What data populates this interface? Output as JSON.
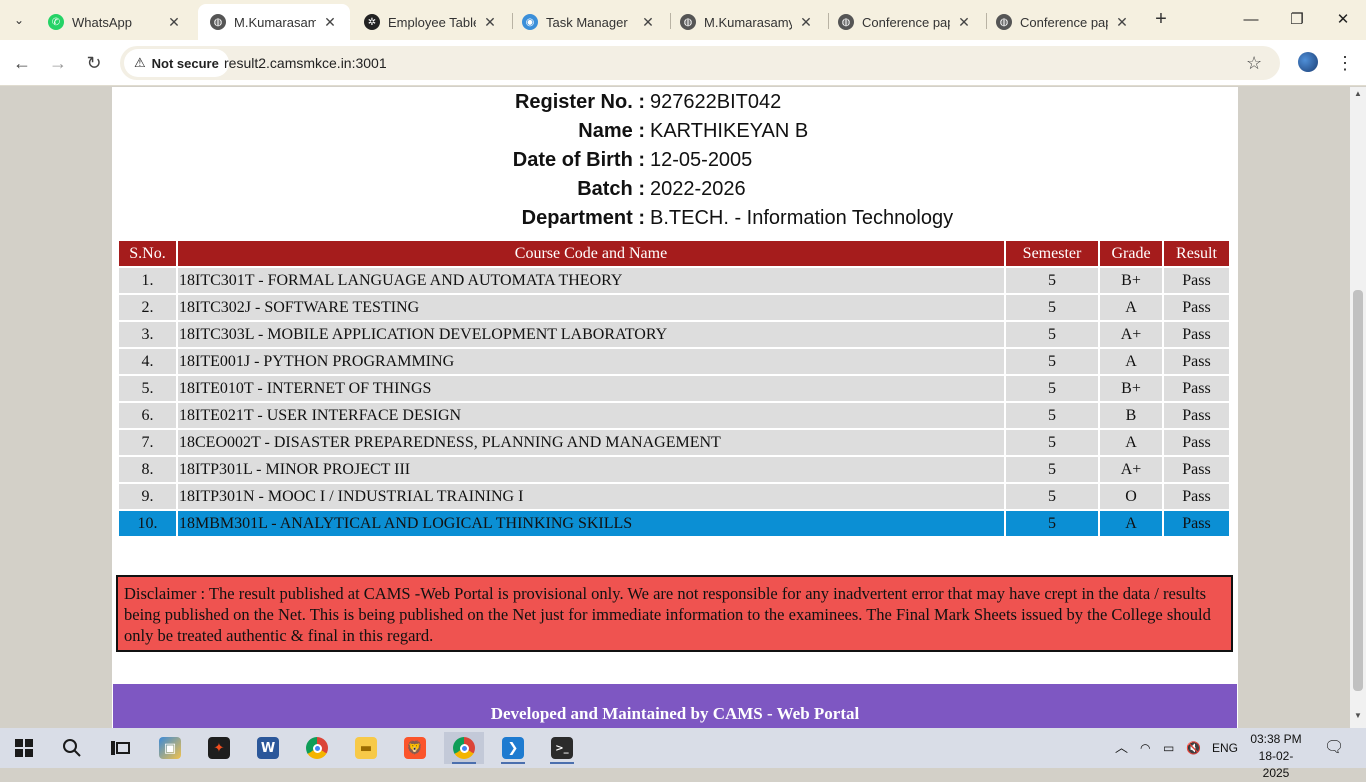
{
  "browser": {
    "tabs": [
      {
        "title": "WhatsApp",
        "active": false
      },
      {
        "title": "M.Kumarasamy C",
        "active": true
      },
      {
        "title": "Employee Table",
        "active": false
      },
      {
        "title": "Task Manager",
        "active": false
      },
      {
        "title": "M.Kumarasamy C",
        "active": false
      },
      {
        "title": "Conference pap",
        "active": false
      },
      {
        "title": "Conference pap",
        "active": false
      }
    ],
    "new_tab": "+",
    "window_controls": {
      "minimize": "—",
      "maximize": "❐",
      "close": "✕"
    },
    "nav": {
      "back": "←",
      "forward": "→",
      "reload": "↻"
    },
    "security_label": "Not secure",
    "url": "result2.camsmkce.in:3001",
    "bookmark": "☆",
    "menu": "⋮"
  },
  "student": {
    "fields": [
      {
        "label": "Register No. :",
        "value": "927622BIT042"
      },
      {
        "label": "Name :",
        "value": "KARTHIKEYAN B"
      },
      {
        "label": "Date of Birth :",
        "value": "12-05-2005"
      },
      {
        "label": "Batch :",
        "value": "2022-2026"
      },
      {
        "label": "Department :",
        "value": "B.TECH. - Information Technology"
      }
    ]
  },
  "results_table": {
    "headers": [
      "S.No.",
      "Course Code and Name",
      "Semester",
      "Grade",
      "Result"
    ],
    "rows": [
      [
        "1.",
        "18ITC301T - FORMAL LANGUAGE AND AUTOMATA THEORY",
        "5",
        "B+",
        "Pass"
      ],
      [
        "2.",
        "18ITC302J - SOFTWARE TESTING",
        "5",
        "A",
        "Pass"
      ],
      [
        "3.",
        "18ITC303L - MOBILE APPLICATION DEVELOPMENT LABORATORY",
        "5",
        "A+",
        "Pass"
      ],
      [
        "4.",
        "18ITE001J - PYTHON PROGRAMMING",
        "5",
        "A",
        "Pass"
      ],
      [
        "5.",
        "18ITE010T - INTERNET OF THINGS",
        "5",
        "B+",
        "Pass"
      ],
      [
        "6.",
        "18ITE021T - USER INTERFACE DESIGN",
        "5",
        "B",
        "Pass"
      ],
      [
        "7.",
        "18CEO002T - DISASTER PREPAREDNESS, PLANNING AND MANAGEMENT",
        "5",
        "A",
        "Pass"
      ],
      [
        "8.",
        "18ITP301L - MINOR PROJECT III",
        "5",
        "A+",
        "Pass"
      ],
      [
        "9.",
        "18ITP301N - MOOC I / INDUSTRIAL TRAINING I",
        "5",
        "O",
        "Pass"
      ],
      [
        "10.",
        "18MBM301L - ANALYTICAL AND LOGICAL THINKING SKILLS",
        "5",
        "A",
        "Pass"
      ]
    ],
    "highlighted_row": 9
  },
  "disclaimer": "Disclaimer : The result published at CAMS -Web Portal is provisional only. We are not responsible for any inadvertent error that may have crept in the data / results being published on the Net. This is being published on the Net just for immediate information to the examinees. The Final Mark Sheets issued by the College should only be treated authentic & final in this regard.",
  "footer": "Developed and Maintained by CAMS - Web Portal",
  "taskbar": {
    "apps": [
      "start-icon",
      "search-icon",
      "task-view-icon",
      "photos-icon",
      "figma-icon",
      "word-icon",
      "chrome-icon",
      "file-explorer-icon",
      "brave-icon",
      "chrome-active-icon",
      "vscode-icon",
      "terminal-icon"
    ],
    "language": "ENG",
    "time": "03:38 PM",
    "date": "18-02-2025"
  },
  "colors": {
    "header_red": "#a51c1c",
    "row_gray": "#dddddd",
    "highlight_blue": "#0b8fd4",
    "disclaimer_red": "#ef5350",
    "footer_purple": "#7e57c2"
  }
}
